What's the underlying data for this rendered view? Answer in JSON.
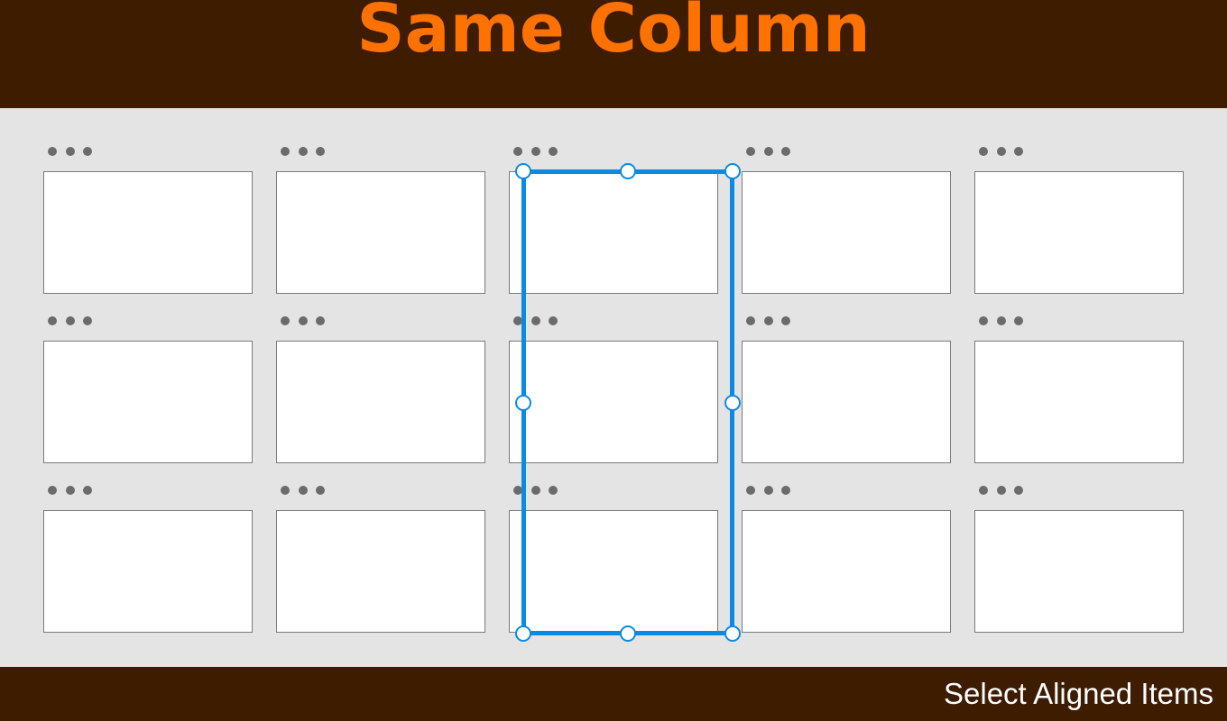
{
  "title": "Same Column",
  "caption": "Select Aligned Items",
  "colors": {
    "header_bg": "#3d1c00",
    "title": "#ff7200",
    "canvas_bg": "#e4e4e4",
    "card_bg": "#ffffff",
    "card_border": "#7a7a7a",
    "dots": "#6b6b6b",
    "selection": "#0a8be3",
    "caption": "#ffffff"
  },
  "grid": {
    "columns": 5,
    "rows": 3
  },
  "selection": {
    "mode": "column",
    "column": 3
  },
  "icons": {
    "card_menu": "more-horizontal-icon",
    "resize_handle": "resize-handle-icon"
  }
}
